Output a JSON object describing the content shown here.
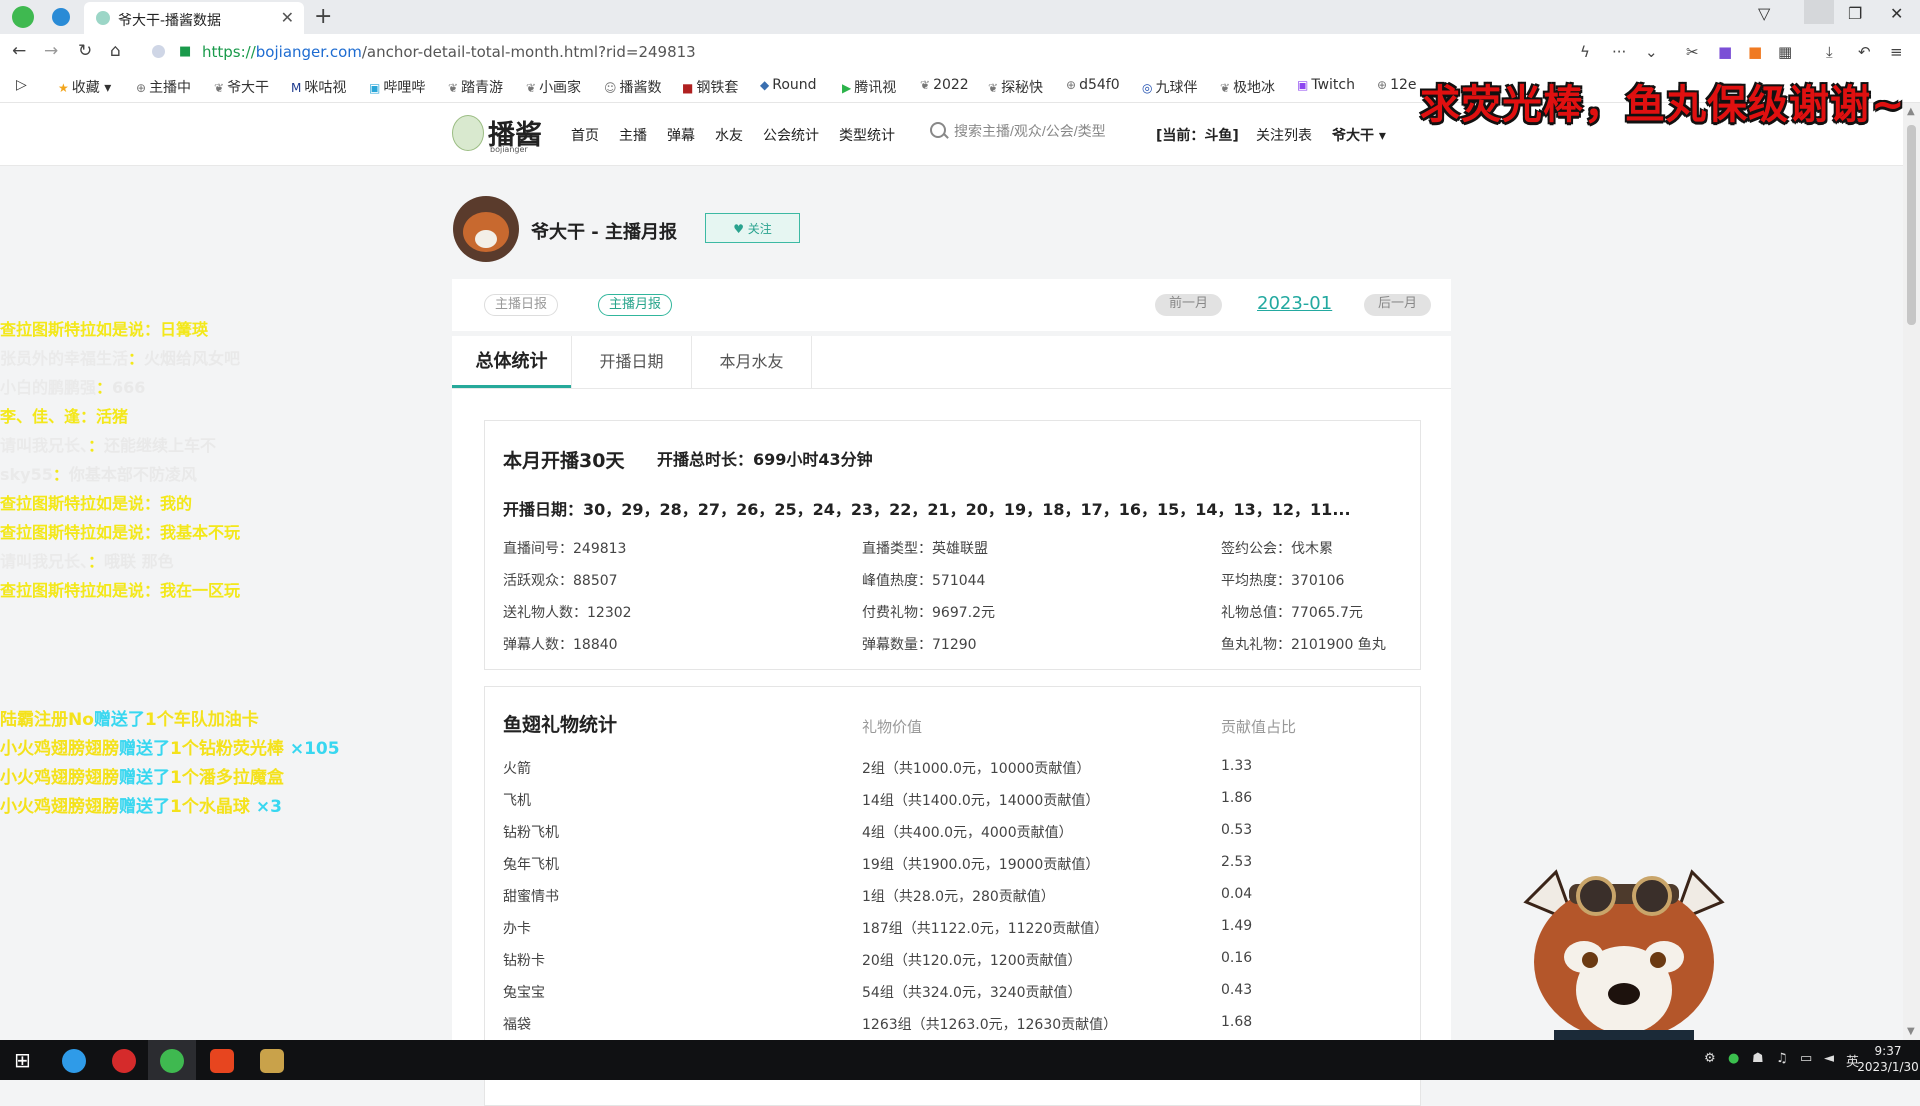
{
  "browser": {
    "tab_title": "爷大干-播酱数据",
    "url_protocol": "https://",
    "url_host": "bojianger.com",
    "url_path": "/anchor-detail-total-month.html?rid=249813",
    "bookmarks": [
      "收藏",
      "主播中",
      "爷大干",
      "咪咕视",
      "哔哩哔",
      "踏青游",
      "小画家",
      "播酱数",
      "钢铁套",
      "Round",
      "腾讯视",
      "2022",
      "探秘快",
      "d54f0",
      "九球伴",
      "极地冰",
      "Twitch",
      "12e"
    ]
  },
  "site": {
    "logo_text": "播酱",
    "logo_sub": "bojianger",
    "nav": [
      "首页",
      "主播",
      "弹幕",
      "水友",
      "公会统计",
      "类型统计"
    ],
    "search_placeholder": "搜索主播/观众/公会/类型",
    "current_platform": "[当前：斗鱼]",
    "follow_list": "关注列表",
    "user_menu": "爷大干 ▾"
  },
  "overlay": {
    "banner": "求荧光棒，鱼丸保级谢谢~",
    "danmaku": [
      {
        "user": "查拉图斯特拉如是说",
        "text": "日篝瑛",
        "white_user": false,
        "white_text": false
      },
      {
        "user": "张员外的幸福生活",
        "text": "火烟给风女吧",
        "white_user": true,
        "white_text": true
      },
      {
        "user": "小白的鹏鹏强",
        "text": "666",
        "white_user": true,
        "white_text": true
      },
      {
        "user": "李、佳、逢",
        "text": "活猪",
        "white_user": false,
        "white_text": false
      },
      {
        "user": "请叫我兄长、",
        "text": "还能继续上车不",
        "white_user": true,
        "white_text": true
      },
      {
        "user": "sky55",
        "text": "你基本部不防凌风",
        "white_user": true,
        "white_text": true
      },
      {
        "user": "查拉图斯特拉如是说",
        "text": "我的",
        "white_user": false,
        "white_text": false
      },
      {
        "user": "查拉图斯特拉如是说",
        "text": "我基本不玩",
        "white_user": false,
        "white_text": false
      },
      {
        "user": "请叫我兄长、",
        "text": "哦联 那色",
        "white_user": true,
        "white_text": true
      },
      {
        "user": "查拉图斯特拉如是说",
        "text": "我在一区玩",
        "white_user": false,
        "white_text": false
      }
    ],
    "gifts": [
      {
        "user": "陆霸注册No",
        "action": "赠送了",
        "count": "1个",
        "item": "车队加油卡",
        "qty": ""
      },
      {
        "user": "小火鸡翅膀翅膀",
        "action": "赠送了",
        "count": "1个",
        "item": "钻粉荧光棒",
        "qty": "×105"
      },
      {
        "user": "小火鸡翅膀翅膀",
        "action": "赠送了",
        "count": "1个",
        "item": "潘多拉魔盒",
        "qty": ""
      },
      {
        "user": "小火鸡翅膀翅膀",
        "action": "赠送了",
        "count": "1个",
        "item": "水晶球",
        "qty": "×3"
      }
    ]
  },
  "profile": {
    "title": "爷大干 - 主播月报",
    "follow_label": "♥ 关注"
  },
  "report": {
    "daily_label": "主播日报",
    "monthly_label": "主播月报",
    "prev_label": "前一月",
    "month": "2023-01",
    "next_label": "后一月",
    "tabs": [
      "总体统计",
      "开播日期",
      "本月水友"
    ]
  },
  "summary": {
    "days": "本月开播30天",
    "duration": "开播总时长：699小时43分钟",
    "dates": "开播日期：30，29，28，27，26，25，24，23，22，21，20，19，18，17，16，15，14，13，12，11...",
    "stats": [
      [
        "直播间号：249813",
        "直播类型：英雄联盟",
        "签约公会：伐木累"
      ],
      [
        "活跃观众：88507",
        "峰值热度：571044",
        "平均热度：370106"
      ],
      [
        "送礼物人数：12302",
        "付费礼物：9697.2元",
        "礼物总值：77065.7元"
      ],
      [
        "弹幕人数：18840",
        "弹幕数量：71290",
        "鱼丸礼物：2101900 鱼丸"
      ]
    ]
  },
  "gift_stats": {
    "title": "鱼翅礼物统计",
    "col_value": "礼物价值",
    "col_ratio": "贡献值占比",
    "rows": [
      [
        "火箭",
        "2组（共1000.0元，10000贡献值）",
        "1.33"
      ],
      [
        "飞机",
        "14组（共1400.0元，14000贡献值）",
        "1.86"
      ],
      [
        "钻粉飞机",
        "4组（共400.0元，4000贡献值）",
        "0.53"
      ],
      [
        "兔年飞机",
        "19组（共1900.0元，19000贡献值）",
        "2.53"
      ],
      [
        "甜蜜情书",
        "1组（共28.0元，280贡献值）",
        "0.04"
      ],
      [
        "办卡",
        "187组（共1122.0元，11220贡献值）",
        "1.49"
      ],
      [
        "钻粉卡",
        "20组（共120.0元，1200贡献值）",
        "0.16"
      ],
      [
        "兔宝宝",
        "54组（共324.0元，3240贡献值）",
        "0.43"
      ],
      [
        "福袋",
        "1263组（共1263.0元，12630贡献值）",
        "1.68"
      ]
    ]
  },
  "taskbar": {
    "ime": "英",
    "time": "9:37",
    "date": "2023/1/30"
  },
  "colors": {
    "accent": "#26a99a",
    "banner_red": "#e01010",
    "danmaku_yellow": "#f3e81a",
    "gift_cyan": "#38d7f0"
  }
}
